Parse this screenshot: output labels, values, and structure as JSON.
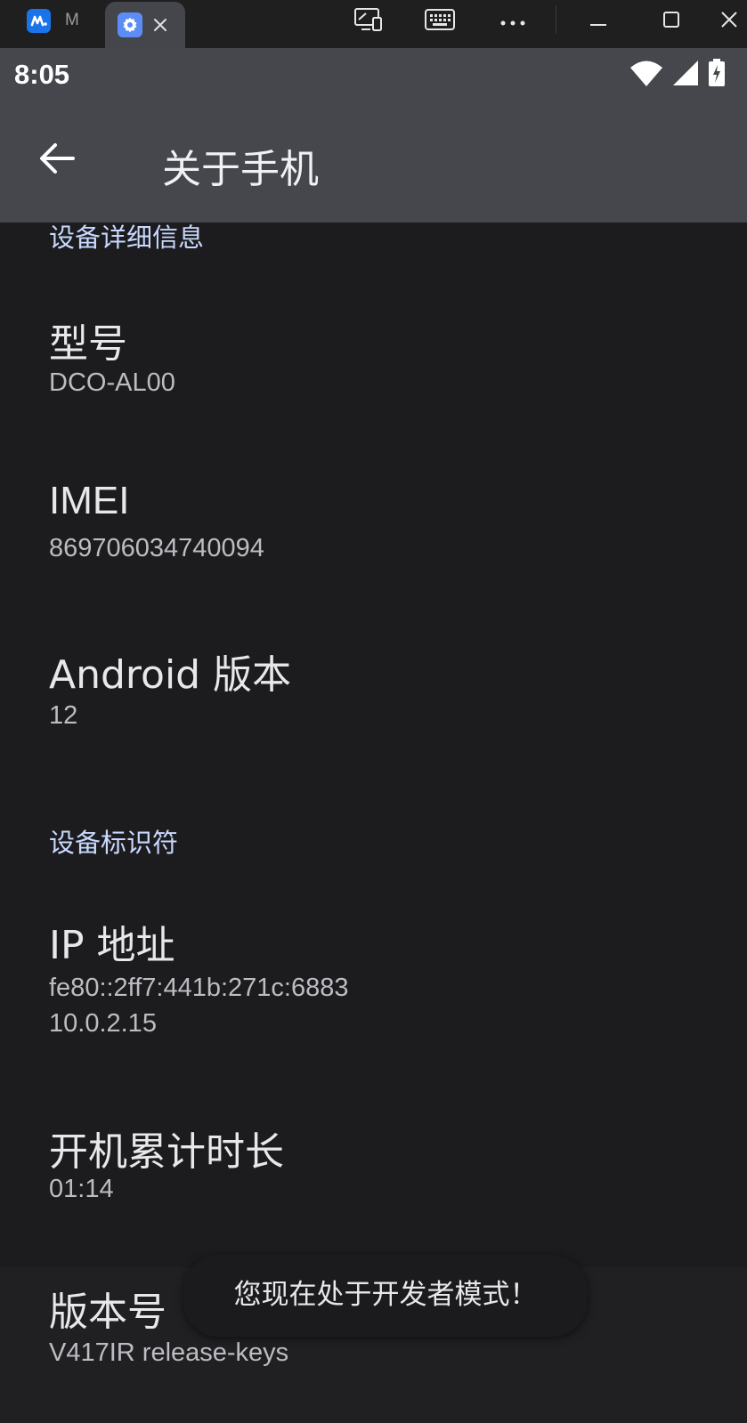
{
  "host": {
    "tabs": [
      {
        "title": "M"
      },
      {
        "title": ""
      }
    ],
    "icons": [
      "monitor-icon",
      "keyboard-icon",
      "more-icon",
      "minimize-icon",
      "maximize-icon",
      "close-icon"
    ]
  },
  "status_bar": {
    "time": "8:05",
    "icons": [
      "wifi-icon",
      "cell-signal-icon",
      "battery-charging-icon"
    ]
  },
  "toolbar": {
    "title": "关于手机"
  },
  "sections": {
    "device_details": {
      "header": "设备详细信息",
      "items": [
        {
          "title": "型号",
          "summary": "DCO-AL00"
        },
        {
          "title": "IMEI",
          "summary": "869706034740094"
        },
        {
          "title": "Android 版本",
          "summary": "12"
        }
      ]
    },
    "device_identifiers": {
      "header": "设备标识符",
      "ip": {
        "title": "IP 地址",
        "summary_lines": [
          "fe80::2ff7:441b:271c:6883",
          "10.0.2.15"
        ]
      },
      "uptime": {
        "title": "开机累计时长",
        "summary": "01:14"
      },
      "build": {
        "title": "版本号",
        "summary": "V417IR release-keys"
      }
    }
  },
  "toast": {
    "message": "您现在处于开发者模式！"
  },
  "colors": {
    "background": "#1c1c1e",
    "app_bar": "#45474d",
    "section_header": "#c8d8ff",
    "accent": "#5c8df6"
  }
}
